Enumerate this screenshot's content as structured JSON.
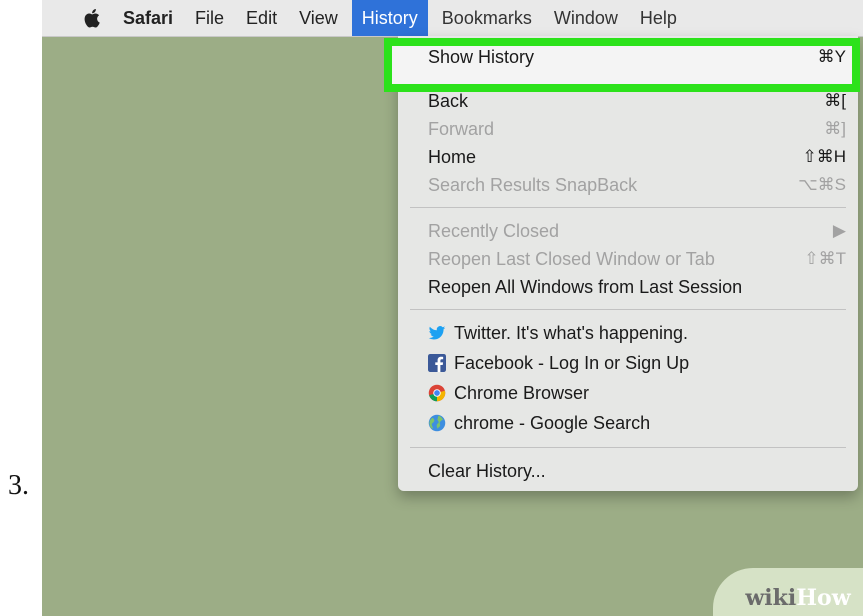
{
  "step_number": "3.",
  "menubar": {
    "items": [
      {
        "label": "Safari"
      },
      {
        "label": "File"
      },
      {
        "label": "Edit"
      },
      {
        "label": "View"
      },
      {
        "label": "History"
      },
      {
        "label": "Bookmarks"
      },
      {
        "label": "Window"
      },
      {
        "label": "Help"
      }
    ]
  },
  "history_menu": {
    "show_history": {
      "label": "Show History",
      "shortcut": "⌘Y"
    },
    "back": {
      "label": "Back",
      "shortcut": "⌘["
    },
    "forward": {
      "label": "Forward",
      "shortcut": "⌘]"
    },
    "home": {
      "label": "Home",
      "shortcut": "⇧⌘H"
    },
    "snapback": {
      "label": "Search Results SnapBack",
      "shortcut": "⌥⌘S"
    },
    "recently_closed": {
      "label": "Recently Closed",
      "shortcut": "▶"
    },
    "reopen_last": {
      "label": "Reopen Last Closed Window or Tab",
      "shortcut": "⇧⌘T"
    },
    "reopen_all": {
      "label": "Reopen All Windows from Last Session"
    },
    "history_items": [
      {
        "label": "Twitter. It's what's happening.",
        "icon": "twitter-icon"
      },
      {
        "label": "Facebook - Log In or Sign Up",
        "icon": "facebook-icon"
      },
      {
        "label": "Chrome Browser",
        "icon": "chrome-icon"
      },
      {
        "label": "chrome - Google Search",
        "icon": "globe-icon"
      }
    ],
    "clear_history": {
      "label": "Clear History..."
    }
  },
  "watermark": {
    "part1": "wiki",
    "part2": "How"
  },
  "colors": {
    "highlight_border": "#2ce21b",
    "desktop": "#9cad86",
    "menu_active": "#2f72d9"
  }
}
